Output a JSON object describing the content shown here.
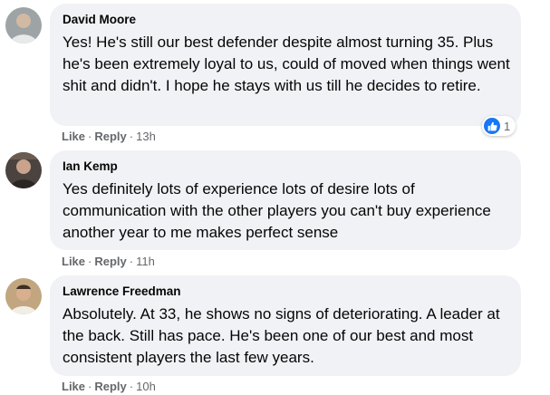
{
  "comments": [
    {
      "author": "David Moore",
      "text": "Yes! He's still our best defender despite almost turning 35. Plus he's been extremely loyal to us, could of moved when things went shit and didn't. I hope he stays with us till he decides to retire.",
      "like_label": "Like",
      "reply_label": "Reply",
      "time": "13h",
      "reaction_count": "1",
      "avatar_icon": "avatar-photo-icon"
    },
    {
      "author": "Ian Kemp",
      "text": "Yes definitely lots of experience lots of desire lots of communication with the other players you can't buy experience another year to me makes perfect sense",
      "like_label": "Like",
      "reply_label": "Reply",
      "time": "11h",
      "avatar_icon": "avatar-photo-icon"
    },
    {
      "author": "Lawrence Freedman",
      "text": "Absolutely. At 33, he shows no signs of deteriorating. A leader at the back. Still has pace. He's been one of our best and most consistent players the last few years.",
      "like_label": "Like",
      "reply_label": "Reply",
      "time": "10h",
      "avatar_icon": "avatar-photo-icon"
    }
  ],
  "reaction_icon": "like-reaction-icon",
  "colors": {
    "bubble": "#f0f2f5",
    "meta": "#65676b",
    "like_blue": "#1877f2"
  }
}
